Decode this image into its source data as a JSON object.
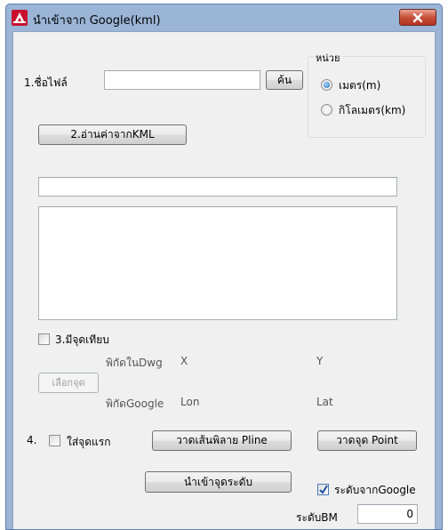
{
  "window": {
    "title": "นำเข้าจาก Google(kml)"
  },
  "file": {
    "label": "1.ชื่อไฟล์",
    "value": "",
    "search_button": "ค้น"
  },
  "unit_group": {
    "title": "หน่วย",
    "options": [
      {
        "label": "เมตร(m)",
        "selected": true
      },
      {
        "label": "กิโลเมตร(km)",
        "selected": false
      }
    ]
  },
  "read_button": "2.อ่านค่าจากKML",
  "status_field": "",
  "list_area": "",
  "compare": {
    "checkbox_label": "3.มีจุดเทียบ",
    "checked": false,
    "dwg_label": "พิกัดในDwg",
    "dwg_x": "X",
    "dwg_y": "Y",
    "pick_button": "เลือกจุด",
    "google_label": "พิกัดGoogle",
    "google_lon": "Lon",
    "google_lat": "Lat"
  },
  "step4": {
    "number": "4.",
    "first_point_label": "ใส่จุดแรก",
    "first_point_checked": false,
    "draw_pline_button": "วาดเส้นพิลาย Pline",
    "draw_point_button": "วาดจุด Point"
  },
  "import_level_button": "นำเข้าจุดระดับ",
  "level_from_google": {
    "label": "ระดับจากGoogle",
    "checked": true
  },
  "bm": {
    "label": "ระดับBM",
    "value": "0"
  },
  "colors": {
    "titlebar": "#9bb5d6",
    "client": "#f0f0f0",
    "close": "#c7503a"
  }
}
